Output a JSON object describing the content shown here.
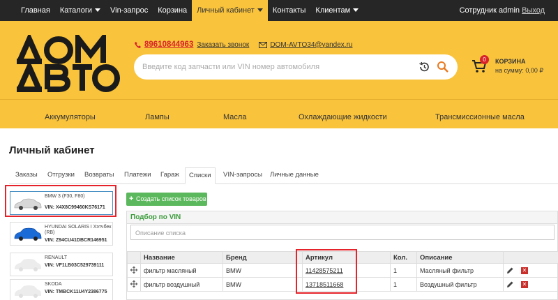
{
  "topnav": {
    "items": [
      {
        "label": "Главная"
      },
      {
        "label": "Каталоги"
      },
      {
        "label": "Vin-запрос"
      },
      {
        "label": "Корзина"
      },
      {
        "label": "Личный кабинет"
      },
      {
        "label": "Контакты"
      },
      {
        "label": "Клиентам"
      }
    ],
    "user_label": "Сотрудник admin",
    "logout": "Выход"
  },
  "header": {
    "logo_alt": "ДОМ АВТО",
    "phone": "89610844963",
    "callback": "Заказать звонок",
    "email": "DOM-AVTO34@yandex.ru",
    "search_placeholder": "Введите код запчасти или VIN номер автомобиля",
    "cart": {
      "count": "0",
      "title": "КОРЗИНА",
      "sum": "на сумму: 0,00 ₽"
    }
  },
  "categories": [
    "Аккумуляторы",
    "Лампы",
    "Масла",
    "Охлаждающие жидкости",
    "Трансмиссионные масла"
  ],
  "page": {
    "title": "Личный кабинет",
    "tabs": [
      "Заказы",
      "Отгрузки",
      "Возвраты",
      "Платежи",
      "Гараж",
      "Списки",
      "VIN-запросы",
      "Личные данные"
    ],
    "active_tab": "Списки"
  },
  "cars": [
    {
      "model": "BMW 3 (F30, F80)",
      "model2": "",
      "vin": "VIN: X4X8C99460KS76171",
      "color": "#d8d8d8"
    },
    {
      "model": "HYUNDAI SOLARIS I Хэтчбек",
      "model2": "(RB)",
      "vin": "VIN: Z94CU41DBCR146951",
      "color": "#1a6ad8"
    },
    {
      "model": "RENAULT",
      "model2": "",
      "vin": "VIN: VF1LB03C529739111",
      "color": "#e8e8e8"
    },
    {
      "model": "SKODA",
      "model2": "",
      "vin": "VIN: TMBCK11U4Y2386775",
      "color": "#e8e8e8"
    }
  ],
  "list": {
    "create_button": "Создать список товаров",
    "title": "Подбор по VIN",
    "description_placeholder": "Описание списка",
    "columns": [
      "Название",
      "Бренд",
      "Артикул",
      "Кол.",
      "Описание"
    ],
    "rows": [
      {
        "name": "фильтр масляный",
        "brand": "BMW",
        "article": "11428575211",
        "qty": "1",
        "desc": "Масляный фильтр"
      },
      {
        "name": "фильтр воздушный",
        "brand": "BMW",
        "article": "13718511668",
        "qty": "1",
        "desc": "Воздушный фильтр"
      }
    ]
  },
  "colors": {
    "accent": "#f9c33c",
    "nav_bg": "#262626",
    "danger": "#d8232a",
    "success": "#5cb85c"
  }
}
